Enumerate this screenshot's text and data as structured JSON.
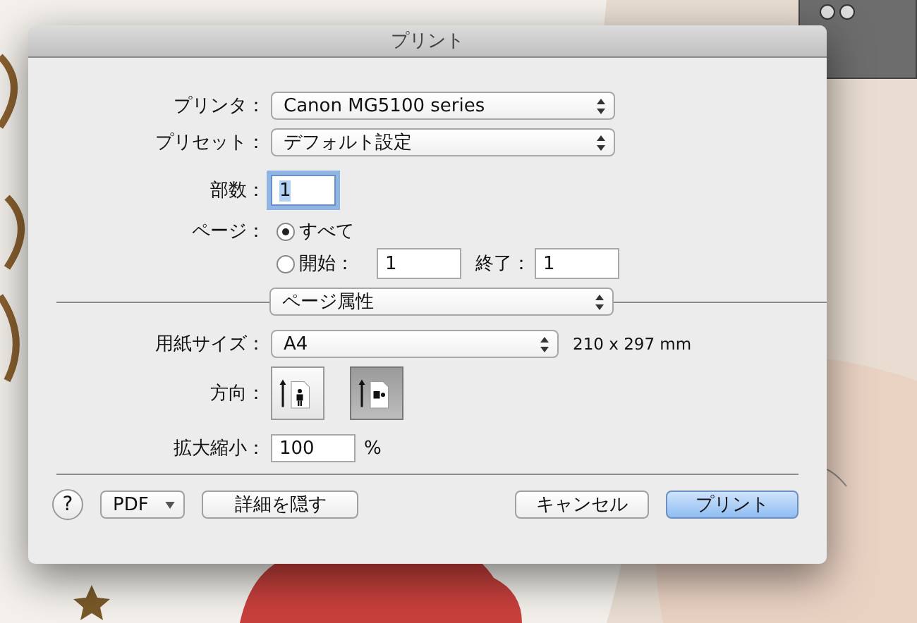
{
  "window": {
    "title": "プリント"
  },
  "printer": {
    "label": "プリンタ：",
    "value": "Canon MG5100 series"
  },
  "preset": {
    "label": "プリセット：",
    "value": "デフォルト設定"
  },
  "copies": {
    "label": "部数：",
    "value": "1",
    "focused": true
  },
  "pages": {
    "label": "ページ：",
    "options": [
      {
        "kind": "all",
        "label": "すべて",
        "selected": true
      },
      {
        "kind": "range",
        "label": "開始：",
        "selected": false,
        "from": "1",
        "to_label": "終了：",
        "to": "1"
      }
    ]
  },
  "section_menu": {
    "value": "ページ属性"
  },
  "paper_size": {
    "label": "用紙サイズ：",
    "value": "A4",
    "dimensions": "210 x 297 mm"
  },
  "orientation": {
    "label": "方向：",
    "options": [
      {
        "kind": "portrait",
        "selected": false
      },
      {
        "kind": "landscape",
        "selected": true
      }
    ]
  },
  "scale": {
    "label": "拡大縮小：",
    "value": "100",
    "unit": "%"
  },
  "left_buttons": [
    {
      "kind": "help",
      "label": "?"
    },
    {
      "kind": "menu",
      "label": "PDF"
    },
    {
      "kind": "normal",
      "label": "詳細を隠す"
    }
  ],
  "right_buttons": [
    {
      "kind": "normal",
      "label": "キャンセル"
    },
    {
      "kind": "default",
      "label": "プリント"
    }
  ]
}
